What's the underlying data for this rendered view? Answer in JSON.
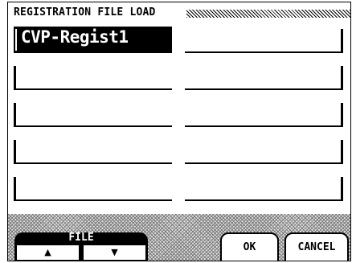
{
  "screen": {
    "title": "REGISTRATION FILE LOAD"
  },
  "files": {
    "selected": "CVP-Regist1",
    "slots": [
      "CVP-Regist1",
      "",
      "",
      "",
      "",
      "",
      "",
      "",
      "",
      ""
    ]
  },
  "controls": {
    "file_label": "FILE",
    "file_up": "▲",
    "file_down": "▼",
    "ok": "OK",
    "cancel": "CANCEL"
  }
}
